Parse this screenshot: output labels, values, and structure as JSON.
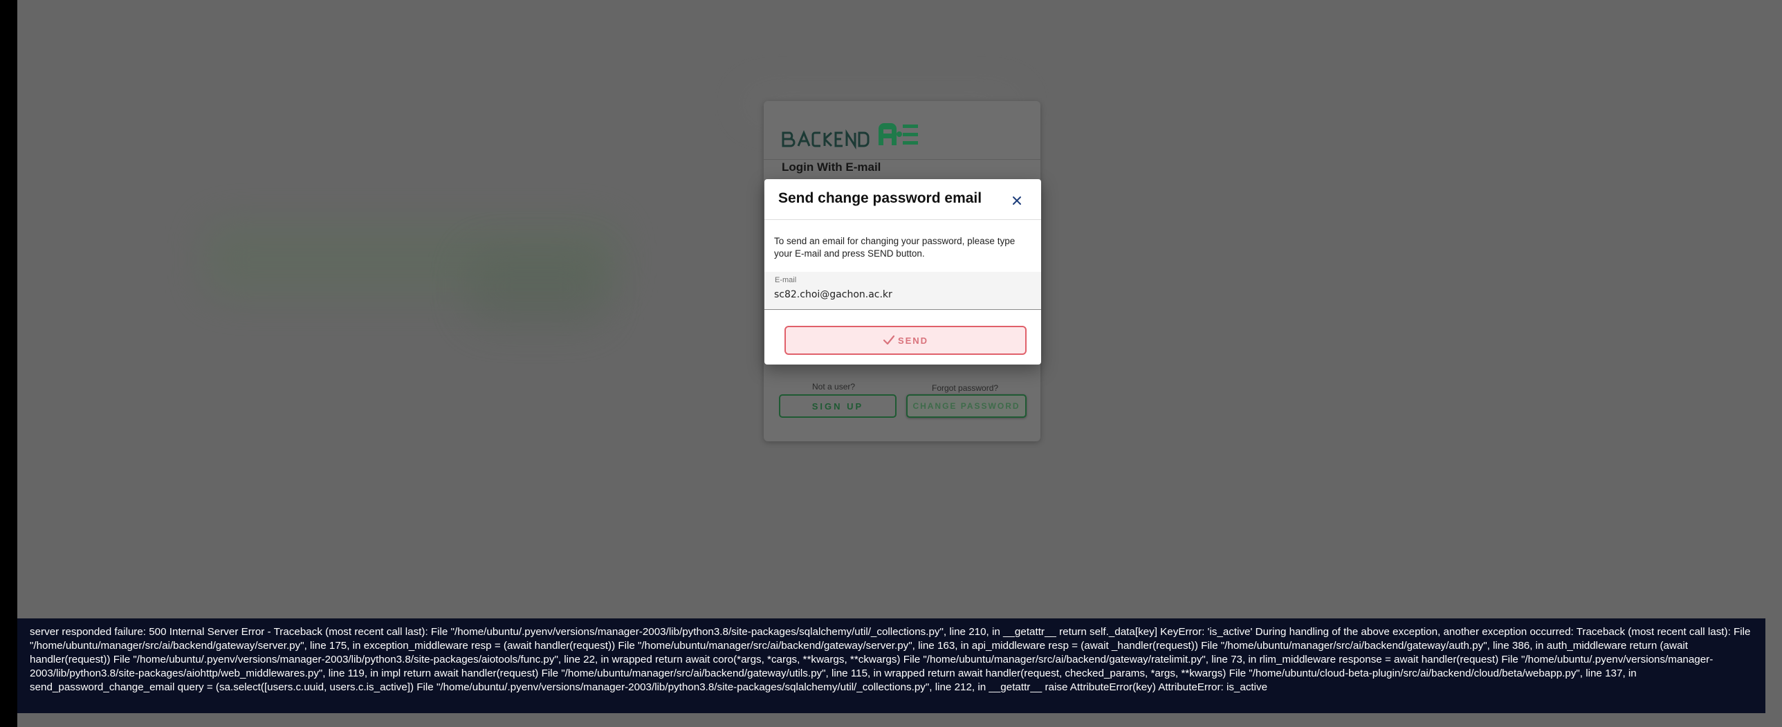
{
  "login": {
    "logo_text": "BACKEND.AI",
    "title": "Login With E-mail",
    "not_a_user": "Not a user?",
    "forgot_password": "Forgot password?",
    "signup_label": "SIGN UP",
    "change_password_label": "CHANGE PASSWORD"
  },
  "dialog": {
    "title": "Send change password email",
    "description": "To send an email for changing your password, please type your E-mail and press SEND button.",
    "email_label": "E-mail",
    "email_value": "sc82.choi@gachon.ac.kr",
    "send_label": "SEND",
    "close_icon": "close-icon",
    "send_icon": "check-icon"
  },
  "error": {
    "message": "server responded failure: 500 Internal Server Error - Traceback (most recent call last): File \"/home/ubuntu/.pyenv/versions/manager-2003/lib/python3.8/site-packages/sqlalchemy/util/_collections.py\", line 210, in __getattr__ return self._data[key] KeyError: 'is_active' During handling of the above exception, another exception occurred: Traceback (most recent call last): File \"/home/ubuntu/manager/src/ai/backend/gateway/server.py\", line 175, in exception_middleware resp = (await handler(request)) File \"/home/ubuntu/manager/src/ai/backend/gateway/server.py\", line 163, in api_middleware resp = (await _handler(request)) File \"/home/ubuntu/manager/src/ai/backend/gateway/auth.py\", line 386, in auth_middleware return (await handler(request)) File \"/home/ubuntu/.pyenv/versions/manager-2003/lib/python3.8/site-packages/aiotools/func.py\", line 22, in wrapped return await coro(*args, *cargs, **kwargs, **ckwargs) File \"/home/ubuntu/manager/src/ai/backend/gateway/ratelimit.py\", line 73, in rlim_middleware response = await handler(request) File \"/home/ubuntu/.pyenv/versions/manager-2003/lib/python3.8/site-packages/aiohttp/web_middlewares.py\", line 119, in impl return await handler(request) File \"/home/ubuntu/manager/src/ai/backend/gateway/utils.py\", line 115, in wrapped return await handler(request, checked_params, *args, **kwargs) File \"/home/ubuntu/cloud-beta-plugin/src/ai/backend/cloud/beta/webapp.py\", line 137, in send_password_change_email query = (sa.select([users.c.uuid, users.c.is_active]) File \"/home/ubuntu/.pyenv/versions/manager-2003/lib/python3.8/site-packages/sqlalchemy/util/_collections.py\", line 212, in __getattr__ raise AttributeError(key) AttributeError: is_active"
  },
  "colors": {
    "accent_green": "#1f5a33",
    "send_border": "#e0606a",
    "send_bg": "#fde8ea",
    "error_bg": "#0a0f24",
    "close_icon": "#1d3d7a"
  }
}
